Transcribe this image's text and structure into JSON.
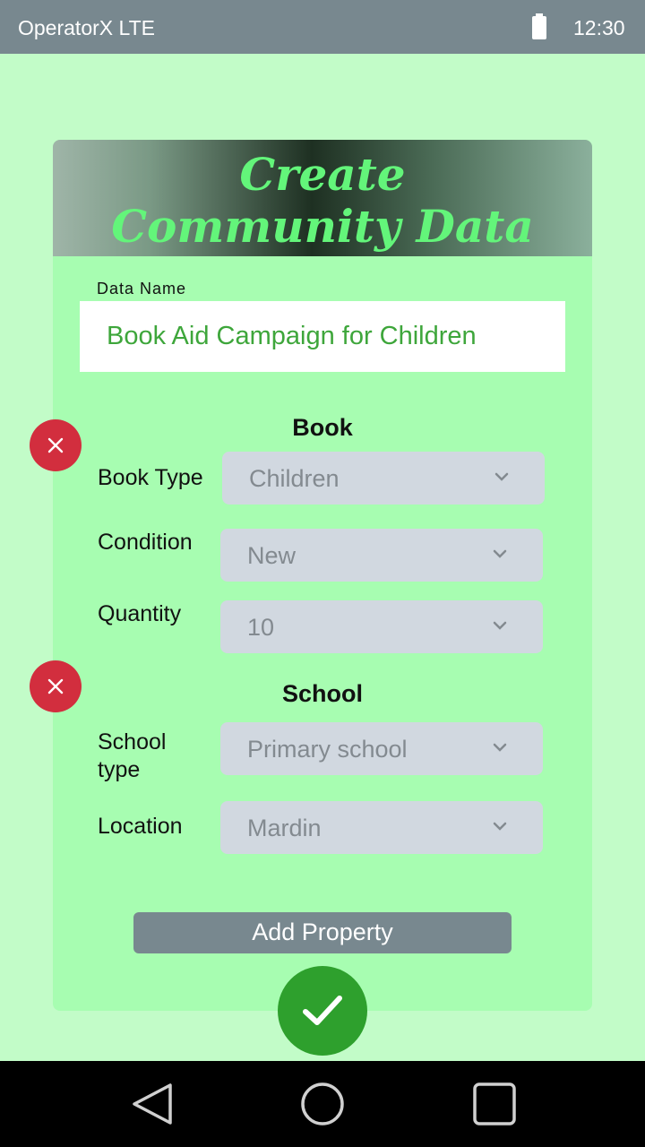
{
  "status_bar": {
    "carrier": "OperatorX LTE",
    "time": "12:30",
    "battery_icon": "battery-full-icon"
  },
  "header": {
    "title_line1": "Create",
    "title_line2": "Community Data"
  },
  "data_name": {
    "label": "Data Name",
    "value": "Book Aid Campaign for Children"
  },
  "sections": {
    "book": {
      "title": "Book",
      "remove_icon": "close-icon",
      "properties": [
        {
          "label": "Book Type",
          "value": "Children"
        },
        {
          "label": "Condition",
          "value": "New"
        },
        {
          "label": "Quantity",
          "value": "10"
        }
      ]
    },
    "school": {
      "title": "School",
      "remove_icon": "close-icon",
      "properties": [
        {
          "label": "School type",
          "value": "Primary school"
        },
        {
          "label": "Location",
          "value": "Mardin"
        }
      ]
    }
  },
  "add_property_label": "Add Property",
  "confirm_icon": "checkmark-icon",
  "nav_bar": {
    "back_icon": "back-triangle-icon",
    "home_icon": "home-circle-icon",
    "recents_icon": "recents-square-icon"
  },
  "colors": {
    "accent": "#2ea02d",
    "danger": "#d22e3e",
    "background": "#c2fcc8",
    "card": "#a7fdb1",
    "title": "#63f57a"
  }
}
